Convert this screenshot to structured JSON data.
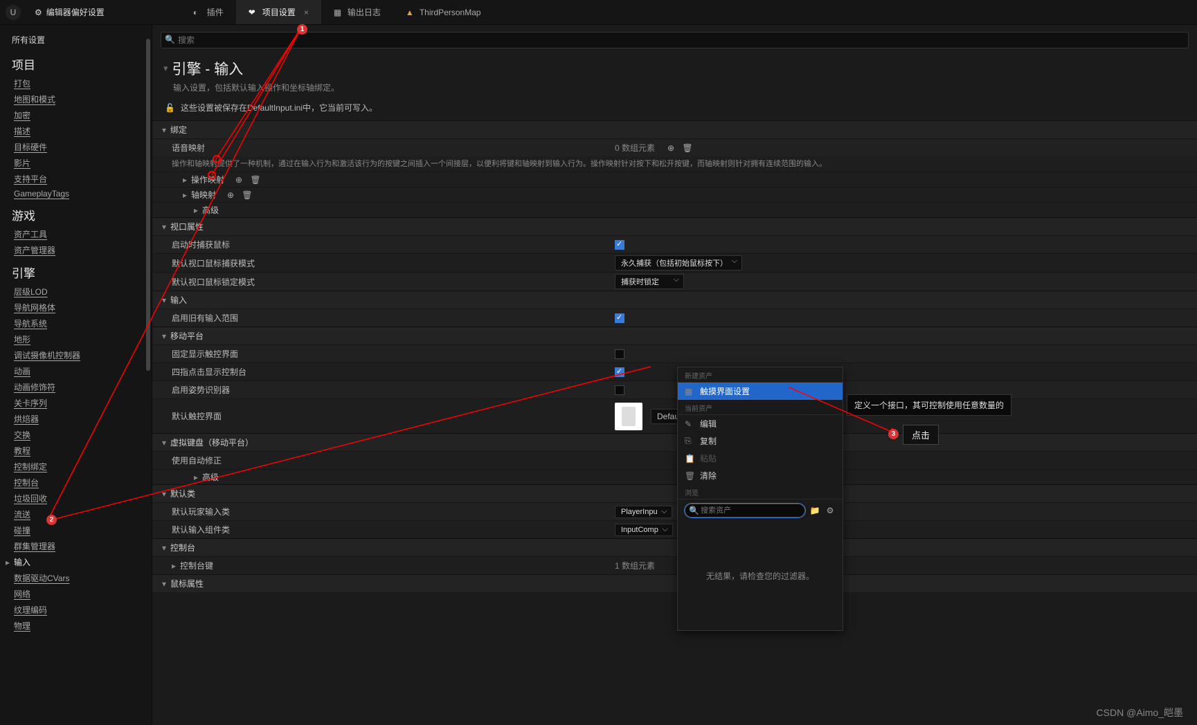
{
  "titlebar": {
    "editor_prefs": "编辑器偏好设置"
  },
  "tabs": [
    {
      "label": "插件"
    },
    {
      "label": "项目设置",
      "active": true
    },
    {
      "label": "输出日志"
    },
    {
      "label": "ThirdPersonMap"
    }
  ],
  "sidebar": {
    "all": "所有设置",
    "sections": [
      {
        "title": "项目",
        "items": [
          "打包",
          "地图和模式",
          "加密",
          "描述",
          "目标硬件",
          "影片",
          "支持平台",
          "GameplayTags"
        ]
      },
      {
        "title": "游戏",
        "items": [
          "资产工具",
          "资产管理器"
        ]
      },
      {
        "title": "引擎",
        "items": [
          "层级LOD",
          "导航网格体",
          "导航系统",
          "地形",
          "调试摄像机控制器",
          "动画",
          "动画修饰符",
          "关卡序列",
          "烘焙器",
          "交换",
          "教程",
          "控制绑定",
          "控制台",
          "垃圾回收",
          "流送",
          "碰撞",
          "群集管理器",
          "输入",
          "数据驱动CVars",
          "网络",
          "纹理编码",
          "物理"
        ]
      }
    ],
    "active_item": "输入"
  },
  "search": {
    "placeholder": "搜索"
  },
  "page": {
    "title": "引擎 - 输入",
    "subtitle": "输入设置，包括默认输入操作和坐标轴绑定。",
    "infobar": "这些设置被保存在DefaultInput.ini中，它当前可写入。"
  },
  "categories": {
    "bindings": {
      "label": "绑定",
      "voice": {
        "label": "语音映射",
        "count": "0 数组元素"
      },
      "desc": "操作和轴映射提供了一种机制，通过在输入行为和激活该行为的按键之间插入一个间接层，以便利将键和轴映射到输入行为。操作映射针对按下和松开按键，而轴映射则针对拥有连续范围的输入。",
      "action": "操作映射",
      "axis": "轴映射",
      "advanced": "高级"
    },
    "viewport": {
      "label": "视口属性",
      "r1": "启动时捕获鼠标",
      "r2": "默认视口鼠标捕获模式",
      "r2v": "永久捕获（包括初始鼠标按下）",
      "r3": "默认视口鼠标锁定模式",
      "r3v": "捕获时锁定"
    },
    "input": {
      "label": "输入",
      "r1": "启用旧有输入范围"
    },
    "mobile": {
      "label": "移动平台",
      "r1": "固定显示触控界面",
      "r2": "四指点击显示控制台",
      "r3": "启用姿势识别器",
      "r4": "默认触控界面",
      "r4v": "DefaultVirtualJoysticks"
    },
    "vkb": {
      "label": "虚拟键盘（移动平台）",
      "r1": "使用自动修正",
      "adv": "高级"
    },
    "defaults": {
      "label": "默认类",
      "r1": "默认玩家输入类",
      "r1v": "PlayerInpu",
      "r2": "默认输入组件类",
      "r2v": "InputComp"
    },
    "console": {
      "label": "控制台",
      "r1": "控制台键",
      "r1v": "1 数组元素",
      "r2": "鼠标属性"
    }
  },
  "context_menu": {
    "s1": "新建资产",
    "i1": "触摸界面设置",
    "s2": "当前资产",
    "edit": "编辑",
    "copy": "复制",
    "paste": "粘贴",
    "clear": "清除",
    "s3": "浏览",
    "search_ph": "搜索资产",
    "noresult": "无结果，请检查您的过滤器。"
  },
  "tooltip": "定义一个接口，其可控制使用任意数量的",
  "click_label": "点击",
  "watermark": "CSDN @Aimo_皑墨",
  "badges": {
    "b1": "1",
    "b2": "2",
    "b3": "3"
  }
}
